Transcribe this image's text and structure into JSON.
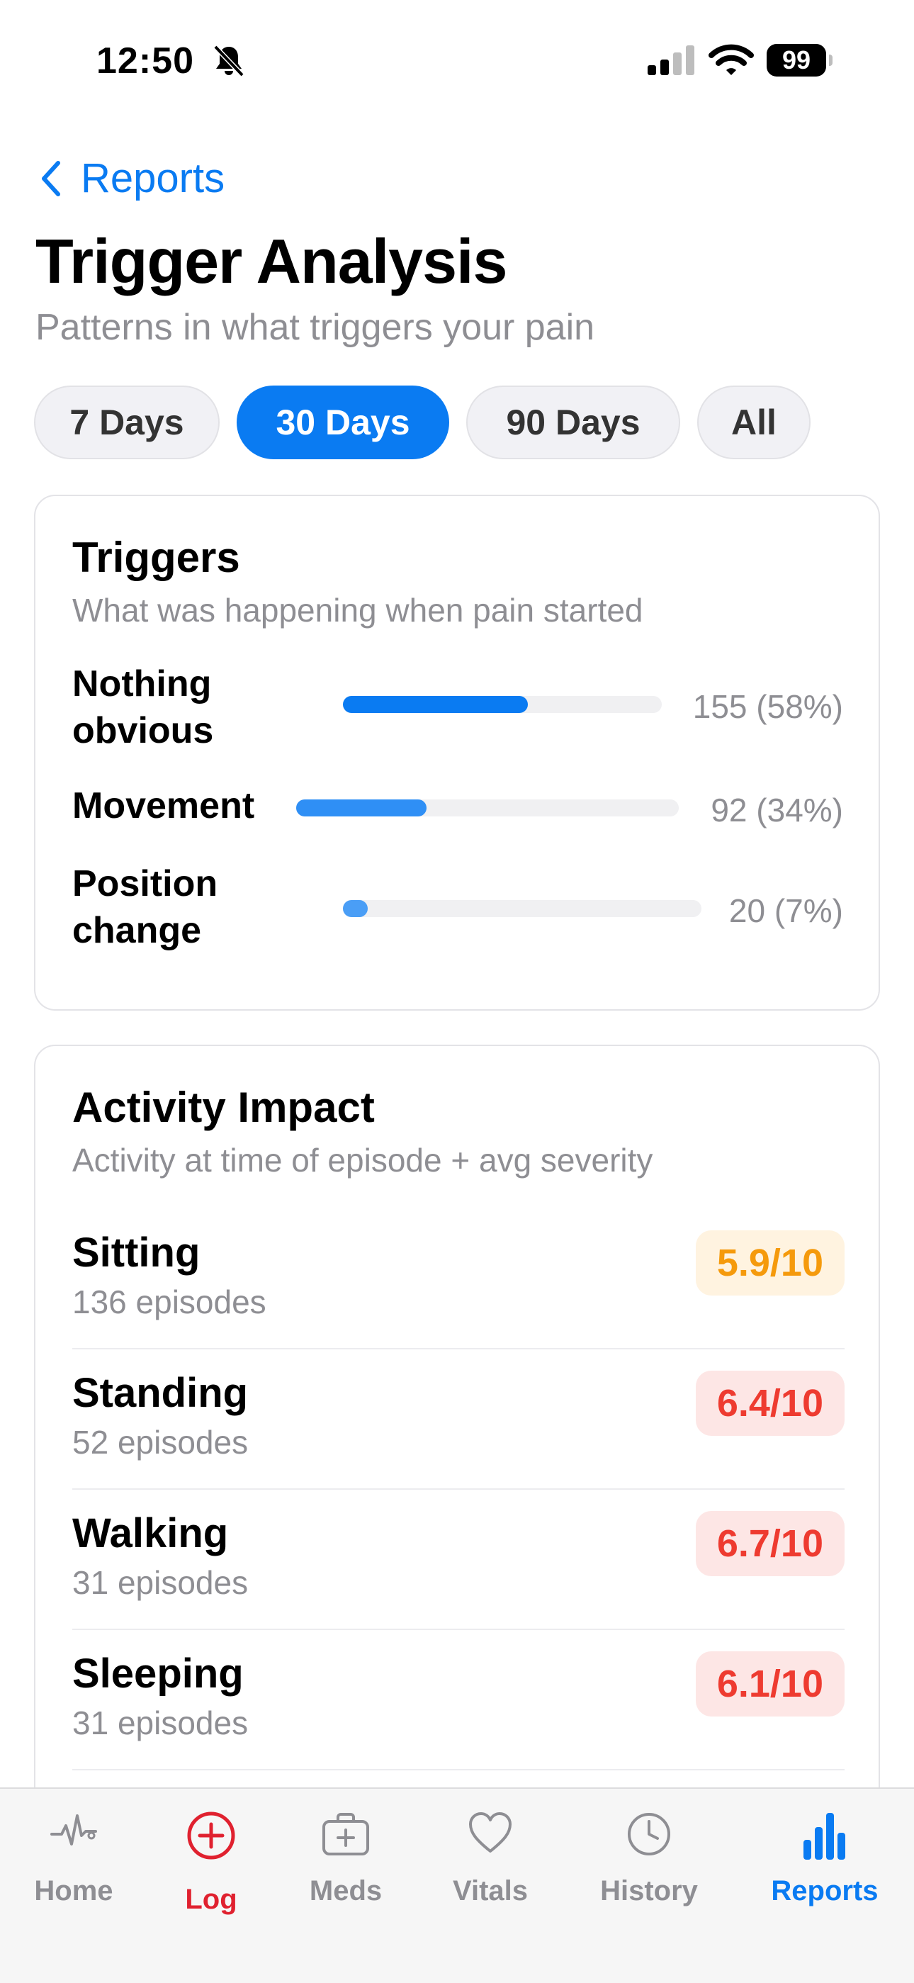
{
  "status_bar": {
    "time": "12:50",
    "battery": "99"
  },
  "nav": {
    "back_label": "Reports"
  },
  "header": {
    "title": "Trigger Analysis",
    "subtitle": "Patterns in what triggers your pain"
  },
  "ranges": {
    "items": [
      "7 Days",
      "30 Days",
      "90 Days",
      "All"
    ],
    "selected": "30 Days"
  },
  "triggers": {
    "title": "Triggers",
    "subtitle": "What was happening when pain started",
    "items": [
      {
        "label_line1": "Nothing",
        "label_line2": "obvious",
        "value": "155 (58%)",
        "fraction": 0.58,
        "color": "#0a7bf2"
      },
      {
        "label": "Movement",
        "value": "92 (34%)",
        "fraction": 0.34,
        "color": "#2f8ff5"
      },
      {
        "label_line1": "Position",
        "label_line2": "change",
        "value": "20 (7%)",
        "fraction": 0.07,
        "color": "#4a9ef6"
      }
    ]
  },
  "activity": {
    "title": "Activity Impact",
    "subtitle": "Activity at time of episode + avg severity",
    "items": [
      {
        "name": "Sitting",
        "episodes": "136 episodes",
        "severity": "5.9/10",
        "level": "orange"
      },
      {
        "name": "Standing",
        "episodes": "52 episodes",
        "severity": "6.4/10",
        "level": "red"
      },
      {
        "name": "Walking",
        "episodes": "31 episodes",
        "severity": "6.7/10",
        "level": "red"
      },
      {
        "name": "Sleeping",
        "episodes": "31 episodes",
        "severity": "6.1/10",
        "level": "red"
      }
    ]
  },
  "tabbar": {
    "items": [
      {
        "label": "Home",
        "icon": "heartbeat-icon"
      },
      {
        "label": "Log",
        "icon": "plus-circle-icon"
      },
      {
        "label": "Meds",
        "icon": "medkit-icon"
      },
      {
        "label": "Vitals",
        "icon": "heart-icon"
      },
      {
        "label": "History",
        "icon": "clock-icon"
      },
      {
        "label": "Reports",
        "icon": "bar-chart-icon"
      }
    ],
    "selected": "Reports",
    "colors": {
      "active": "#0a7bf2",
      "log": "#e0212f",
      "inactive": "#8e8e93"
    }
  }
}
